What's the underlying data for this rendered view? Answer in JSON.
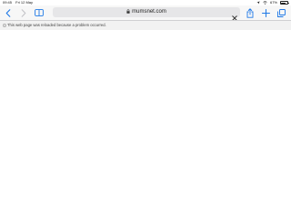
{
  "status_bar": {
    "time": "09:45",
    "date": "Fri 12 May",
    "battery_text": "67%",
    "battery_level": 0.67
  },
  "toolbar": {
    "url": "mumsnet.com",
    "accent_color": "#1e78e6",
    "icons": [
      "back-icon",
      "forward-icon",
      "sidebar-icon",
      "lock-icon",
      "stop-icon",
      "share-icon",
      "new-tab-icon",
      "tabs-icon"
    ]
  },
  "notice": {
    "message": "This web page was reloaded because a problem occurred."
  }
}
